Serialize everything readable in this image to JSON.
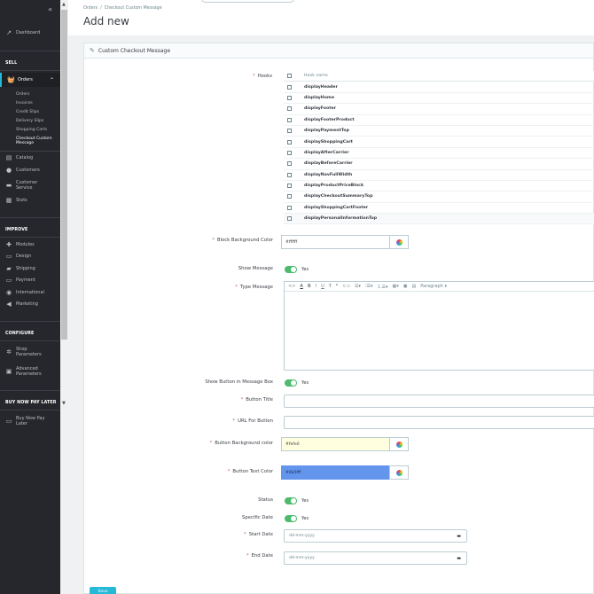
{
  "sidebar": {
    "dashboard": "Dashboard",
    "sections": {
      "sell": "SELL",
      "improve": "IMPROVE",
      "configure": "CONFIGURE",
      "bnpl": "BUY NOW PAY LATER"
    },
    "orders": "Orders",
    "orders_sub": [
      "Orders",
      "Invoices",
      "Credit Slips",
      "Delivery Slips",
      "Shopping Carts",
      "Checkout Custom Message"
    ],
    "catalog": "Catalog",
    "customers": "Customers",
    "customer_service": "Customer Service",
    "stats": "Stats",
    "modules": "Modules",
    "design": "Design",
    "shipping": "Shipping",
    "payment": "Payment",
    "international": "International",
    "marketing": "Marketing",
    "shop_parameters": "Shop Parameters",
    "advanced_parameters": "Advanced Parameters",
    "buy_now_pay_later": "Buy Now Pay Later"
  },
  "header": {
    "breadcrumb": [
      "Orders",
      "Checkout Custom Message"
    ],
    "breadcrumb_sep": "/",
    "title": "Add new"
  },
  "card": {
    "title": "Custom Checkout Message",
    "labels": {
      "hooks": "Hooks",
      "block_bg": "Block Background Color",
      "show_message": "Show Message",
      "type_message": "Type Message",
      "show_button": "Show Button in Message Box",
      "button_title": "Button Title",
      "url_button": "URL For Button",
      "button_bg": "Button Background color",
      "button_text_color": "Button Text Color",
      "status": "Status",
      "specific_date": "Specific Date",
      "start_date": "Start Date",
      "end_date": "End Date"
    },
    "hooks_header": "Hook name",
    "hooks": [
      "displayHeader",
      "displayHome",
      "displayFooter",
      "displayFooterProduct",
      "displayPaymentTop",
      "displayShoppingCart",
      "displayAfterCarrier",
      "displayBeforeCarrier",
      "displayNavFullWidth",
      "displayProductPriceBlock",
      "displayCheckoutSummaryTop",
      "displayShoppingCartFooter",
      "displayPersonalInformationTop"
    ],
    "block_bg_value": "#ffffff",
    "button_bg_value": "#ffffe0",
    "button_text_value": "#6495ed",
    "button_bg_display": "#fefe0",
    "button_text_display": "#6b5fff",
    "yes": "Yes",
    "editor_paragraph": "Paragraph",
    "date_placeholder": "dd-mm-yyyy",
    "save": "Save"
  },
  "colors": {
    "accent": "#25b9d7",
    "toggle": "#4cbb6c",
    "sidebar": "#25272c"
  }
}
